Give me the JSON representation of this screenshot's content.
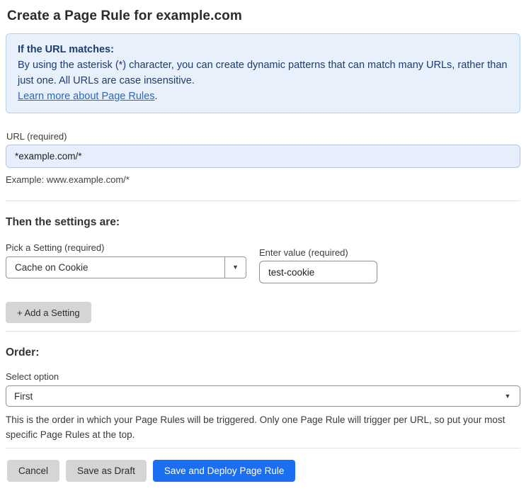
{
  "page": {
    "title": "Create a Page Rule for example.com"
  },
  "info_box": {
    "heading": "If the URL matches:",
    "body": "By using the asterisk (*) character, you can create dynamic patterns that can match many URLs, rather than just one. All URLs are case insensitive.",
    "link_label": "Learn more about Page Rules",
    "link_suffix": "."
  },
  "url_field": {
    "label": "URL (required)",
    "value": "*example.com/*",
    "helper": "Example: www.example.com/*"
  },
  "settings": {
    "heading": "Then the settings are:",
    "setting_label": "Pick a Setting (required)",
    "setting_value": "Cache on Cookie",
    "value_label": "Enter value (required)",
    "value_value": "test-cookie",
    "add_button_label": "+ Add a Setting"
  },
  "order": {
    "heading": "Order:",
    "select_label": "Select option",
    "select_value": "First",
    "helper": "This is the order in which your Page Rules will be triggered. Only one Page Rule will trigger per URL, so put your most specific Page Rules at the top."
  },
  "footer": {
    "cancel_label": "Cancel",
    "save_draft_label": "Save as Draft",
    "save_deploy_label": "Save and Deploy Page Rule"
  },
  "icons": {
    "dropdown_arrow": "▼"
  },
  "colors": {
    "info_box_bg": "#e8f1fb",
    "info_box_border": "#b7d3f0",
    "info_text": "#1d3c6f",
    "link": "#2a66c4",
    "url_input_bg": "#e7effc",
    "url_input_border": "#b6c4e2",
    "primary_button": "#1a6ef2",
    "gray_button": "#d5d5d5",
    "divider": "#e2e2e2"
  }
}
